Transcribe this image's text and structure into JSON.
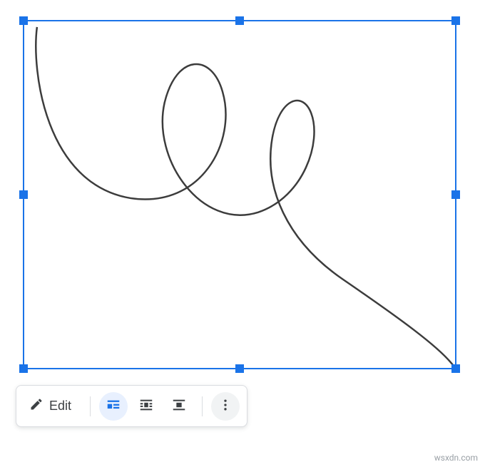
{
  "selection": {
    "type": "drawing-object",
    "border_color": "#1a73e8",
    "handle_color": "#1a73e8"
  },
  "toolbar": {
    "edit_label": "Edit",
    "wrap_options": {
      "inline": "In line",
      "wrap": "Wrap text",
      "break": "Break text"
    },
    "selected_wrap": "inline"
  },
  "icons": {
    "pencil": "pencil-icon",
    "inline": "wrap-inline-icon",
    "wrap": "wrap-text-icon",
    "break": "break-text-icon",
    "more": "more-vertical-icon"
  },
  "watermark": "wsxdn.com"
}
